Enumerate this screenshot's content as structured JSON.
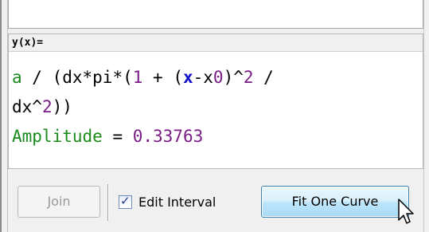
{
  "editor": {
    "label": "y(x)=",
    "lines": [
      [
        {
          "text": "a",
          "role": "variable"
        },
        {
          "text": " / (dx*pi*(",
          "role": "operator"
        },
        {
          "text": "1",
          "role": "number"
        },
        {
          "text": " + (",
          "role": "operator"
        },
        {
          "text": "x",
          "role": "independent-variable"
        },
        {
          "text": "-x0)^",
          "role": "operator-mixed"
        },
        {
          "text": "2",
          "role": "number"
        },
        {
          "text": " /",
          "role": "operator"
        }
      ],
      [
        {
          "text": "dx^",
          "role": "operator-mixed"
        },
        {
          "text": "2",
          "role": "number"
        },
        {
          "text": "))",
          "role": "operator"
        }
      ],
      [
        {
          "text": "Amplitude",
          "role": "variable"
        },
        {
          "text": " = ",
          "role": "operator"
        },
        {
          "text": "0.33763",
          "role": "number"
        }
      ]
    ]
  },
  "toolbar": {
    "join_label": "Join",
    "edit_interval_label": "Edit Interval",
    "edit_interval_checked": true,
    "fit_one_curve_label": "Fit One Curve"
  },
  "colors": {
    "variable": "#1a8a1a",
    "number": "#7a1e86",
    "operator": "#000000",
    "independent_variable": "#1010c8",
    "fit_button_border": "#3c7fb1"
  },
  "icons": {
    "checkbox": "checkmark-icon",
    "cursor": "mouse-pointer-icon"
  }
}
